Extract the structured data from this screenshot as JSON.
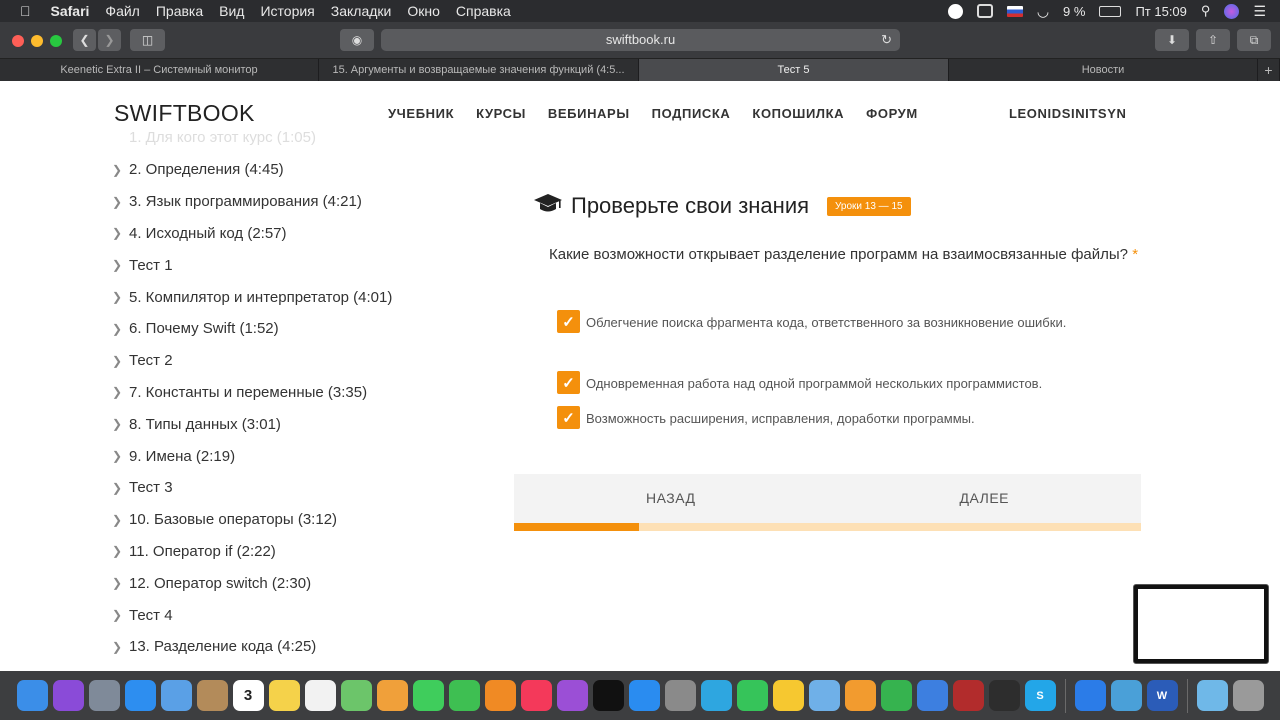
{
  "menubar": {
    "app": "Safari",
    "items": [
      "Файл",
      "Правка",
      "Вид",
      "История",
      "Закладки",
      "Окно",
      "Справка"
    ],
    "battery": "9 %",
    "clock": "Пт 15:09"
  },
  "browser": {
    "url": "swiftbook.ru",
    "tabs": [
      {
        "label": "Keenetic Extra II – Системный монитор"
      },
      {
        "label": "15. Аргументы и возвращаемые значения функций (4:5..."
      },
      {
        "label": "Тест 5"
      },
      {
        "label": "Новости"
      }
    ],
    "new_tab": "+"
  },
  "site": {
    "logo": "SWIFTBOOK",
    "nav": [
      "УЧЕБНИК",
      "КУРСЫ",
      "ВЕБИНАРЫ",
      "ПОДПИСКА",
      "КОПОШИЛКА",
      "ФОРУМ"
    ],
    "user": "LEONIDSINITSYN"
  },
  "lessons_partial": "1. Для кого этот курс (1:05)",
  "lessons": [
    "2. Определения (4:45)",
    "3. Язык программирования (4:21)",
    "4. Исходный код (2:57)",
    "Тест 1",
    "5. Компилятор и интерпретатор (4:01)",
    "6. Почему Swift (1:52)",
    "Тест 2",
    "7. Константы и переменные (3:35)",
    "8. Типы данных (3:01)",
    "9. Имена (2:19)",
    "Тест 3",
    "10. Базовые операторы (3:12)",
    "11. Оператор if (2:22)",
    "12. Оператор switch (2:30)",
    "Тест 4",
    "13. Разделение кода (4:25)"
  ],
  "quiz": {
    "title": "Проверьте свои знания",
    "badge": "Уроки 13 — 15",
    "question": "Какие возможности открывает разделение программ на взаимосвязанные файлы?",
    "required_mark": "*",
    "options": [
      {
        "label": "Облегчение поиска фрагмента кода, ответственного за возникновение ошибки.",
        "checked": true
      },
      {
        "label": "Одновременная работа над одной программой нескольких программистов.",
        "checked": true
      },
      {
        "label": "Возможность расширения, исправления, доработки программы.",
        "checked": true
      }
    ],
    "back_label": "НАЗАД",
    "next_label": "ДАЛЕЕ",
    "progress": 0.2
  },
  "colors": {
    "accent": "#f4900c",
    "accent_light": "#fde0b5"
  },
  "dock": [
    {
      "name": "finder",
      "color": "#3b8ee8"
    },
    {
      "name": "siri",
      "color": "#8a4bd8"
    },
    {
      "name": "launchpad",
      "color": "#7f8a99"
    },
    {
      "name": "safari",
      "color": "#2d8ef0"
    },
    {
      "name": "mail",
      "color": "#5aa0e6"
    },
    {
      "name": "contacts",
      "color": "#b38b5a"
    },
    {
      "name": "calendar",
      "color": "#ffffff"
    },
    {
      "name": "notes",
      "color": "#f5d24a"
    },
    {
      "name": "reminders",
      "color": "#f2f2f2"
    },
    {
      "name": "maps",
      "color": "#6cc56a"
    },
    {
      "name": "photos",
      "color": "#f0a03a"
    },
    {
      "name": "messages",
      "color": "#3fcd5c"
    },
    {
      "name": "facetime",
      "color": "#3ebf52"
    },
    {
      "name": "books",
      "color": "#f08a24"
    },
    {
      "name": "music",
      "color": "#f4395a"
    },
    {
      "name": "podcasts",
      "color": "#9b4fd6"
    },
    {
      "name": "tv",
      "color": "#111111"
    },
    {
      "name": "app-store",
      "color": "#2a8cf0"
    },
    {
      "name": "system-preferences",
      "color": "#8a8a8a"
    },
    {
      "name": "telegram",
      "color": "#2ea6e0"
    },
    {
      "name": "whatsapp",
      "color": "#36c45a"
    },
    {
      "name": "tips",
      "color": "#f6c830"
    },
    {
      "name": "preview",
      "color": "#6fb0e8"
    },
    {
      "name": "pages",
      "color": "#f29b2f"
    },
    {
      "name": "numbers",
      "color": "#36b34f"
    },
    {
      "name": "keynote",
      "color": "#3d7fe0"
    },
    {
      "name": "dictionary",
      "color": "#b22c2c"
    },
    {
      "name": "activity-monitor",
      "color": "#2d2d2d"
    },
    {
      "name": "skype",
      "color": "#23a6e8"
    },
    {
      "name": "xcode",
      "color": "#2b7ce8"
    },
    {
      "name": "network-utility",
      "color": "#4aa0d8"
    },
    {
      "name": "word",
      "color": "#2b5cb8"
    },
    {
      "name": "downloads-folder",
      "color": "#6fb8e8"
    },
    {
      "name": "trash",
      "color": "#9a9a9a"
    }
  ],
  "dock_calendar_day": "3",
  "dock_word_letter": "W",
  "dock_skype_letter": "S"
}
